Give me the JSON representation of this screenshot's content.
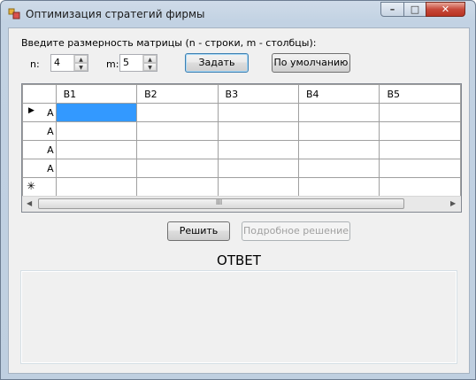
{
  "window": {
    "title": "Оптимизация стратегий фирмы"
  },
  "controls": {
    "minimize": "–",
    "maximize": "□",
    "close": "✕"
  },
  "form": {
    "prompt": "Введите размерность матрицы (n - строки, m - столбцы):",
    "n_label": "n:",
    "n_value": "4",
    "m_label": "m:",
    "m_value": "5",
    "set_button": "Задать",
    "default_button": "По умолчанию"
  },
  "grid": {
    "columns": [
      "B1",
      "B2",
      "B3",
      "B4",
      "B5"
    ],
    "rows": [
      {
        "indicator": "▶",
        "header": "A",
        "cells": [
          "",
          "",
          "",
          "",
          ""
        ],
        "selected_col": 0
      },
      {
        "indicator": "",
        "header": "A",
        "cells": [
          "",
          "",
          "",
          "",
          ""
        ]
      },
      {
        "indicator": "",
        "header": "A",
        "cells": [
          "",
          "",
          "",
          "",
          ""
        ]
      },
      {
        "indicator": "",
        "header": "A",
        "cells": [
          "",
          "",
          "",
          "",
          ""
        ]
      },
      {
        "indicator": "✳",
        "header": "",
        "cells": [
          "",
          "",
          "",
          "",
          ""
        ]
      }
    ],
    "scroll_left": "◀",
    "scroll_right": "▶",
    "scroll_grip": "III"
  },
  "actions": {
    "solve_button": "Решить",
    "detailed_button": "Подробное решение"
  },
  "answer": {
    "title": "ОТВЕТ",
    "text": ""
  }
}
